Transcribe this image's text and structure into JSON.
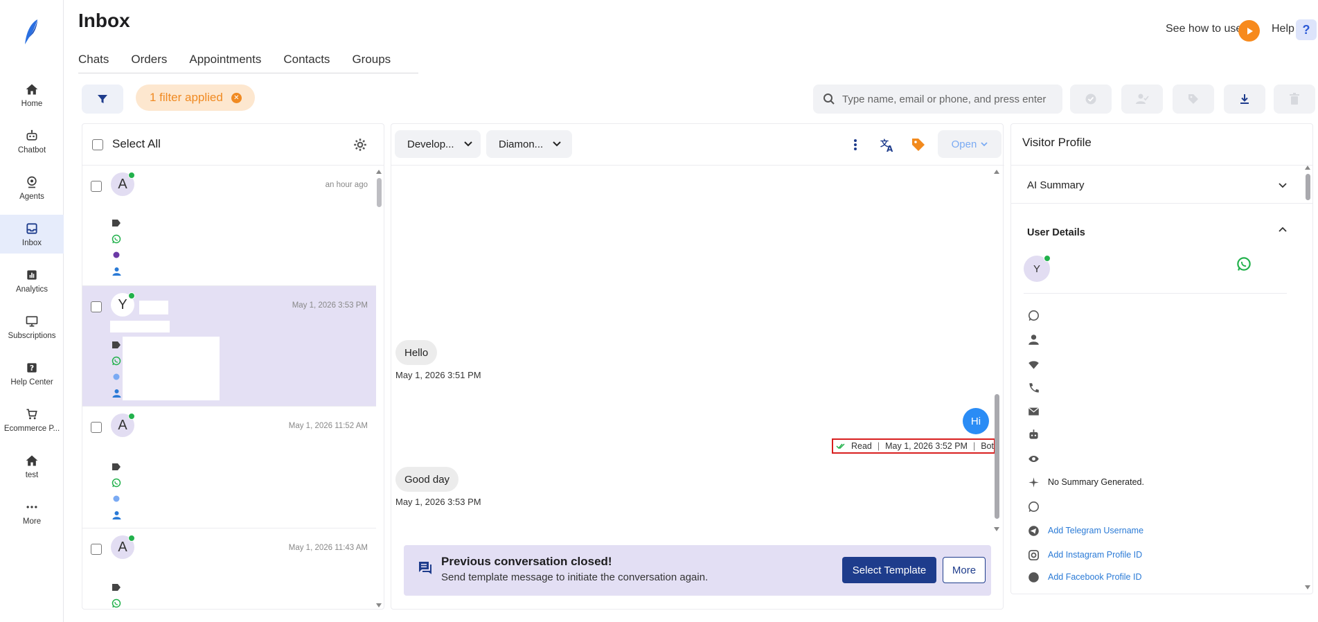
{
  "app": {
    "title": "Inbox",
    "how_to": "See how to use",
    "help": "Help",
    "help_icon_text": "?"
  },
  "nav": [
    {
      "label": "Home",
      "icon": "home-icon"
    },
    {
      "label": "Chatbot",
      "icon": "robot-icon"
    },
    {
      "label": "Agents",
      "icon": "agent-icon"
    },
    {
      "label": "Inbox",
      "icon": "inbox-icon"
    },
    {
      "label": "Analytics",
      "icon": "analytics-icon"
    },
    {
      "label": "Subscriptions",
      "icon": "monitor-icon"
    },
    {
      "label": "Help Center",
      "icon": "help-icon"
    },
    {
      "label": "Ecommerce P...",
      "icon": "cart-icon"
    },
    {
      "label": "test",
      "icon": "home-icon"
    },
    {
      "label": "More",
      "icon": "more-icon"
    }
  ],
  "tabs": [
    "Chats",
    "Orders",
    "Appointments",
    "Contacts",
    "Groups"
  ],
  "filter": {
    "applied_label": "1 filter applied",
    "search_placeholder": "Type name, email or phone, and press enter"
  },
  "list": {
    "select_all": "Select All",
    "items": [
      {
        "initial": "A",
        "time": "an hour ago"
      },
      {
        "initial": "Y",
        "time": "May 1, 2026 3:53 PM"
      },
      {
        "initial": "A",
        "time": "May 1, 2026 11:52 AM"
      },
      {
        "initial": "A",
        "time": "May 1, 2026 11:43 AM"
      }
    ]
  },
  "conversation": {
    "dropdown1": "Develop...",
    "dropdown2": "Diamon...",
    "status": "Open",
    "messages": [
      {
        "dir": "in",
        "text": "Hello",
        "time": "May 1, 2026 3:51 PM"
      },
      {
        "dir": "out",
        "text": "Hi",
        "status": "Read",
        "time": "May 1, 2026 3:52 PM",
        "sender": "Bot"
      },
      {
        "dir": "in",
        "text": "Good day",
        "time": "May 1, 2026 3:53 PM"
      }
    ],
    "closed_title": "Previous conversation closed!",
    "closed_sub": "Send template message to initiate the conversation again.",
    "select_template": "Select Template",
    "more": "More"
  },
  "profile": {
    "title": "Visitor Profile",
    "ai_summary": "AI Summary",
    "user_details": "User Details",
    "initial": "Y",
    "no_summary": "No Summary Generated.",
    "add_telegram": "Add Telegram Username",
    "add_instagram": "Add Instagram Profile ID",
    "add_facebook": "Add Facebook Profile ID"
  },
  "colors": {
    "accent": "#2a8cf5",
    "brand_dark": "#1e3c8c",
    "orange": "#f78a1d",
    "whatsapp": "#22b14c",
    "selected_row": "#e4e0f4",
    "highlight_box": "#d81e1e"
  }
}
